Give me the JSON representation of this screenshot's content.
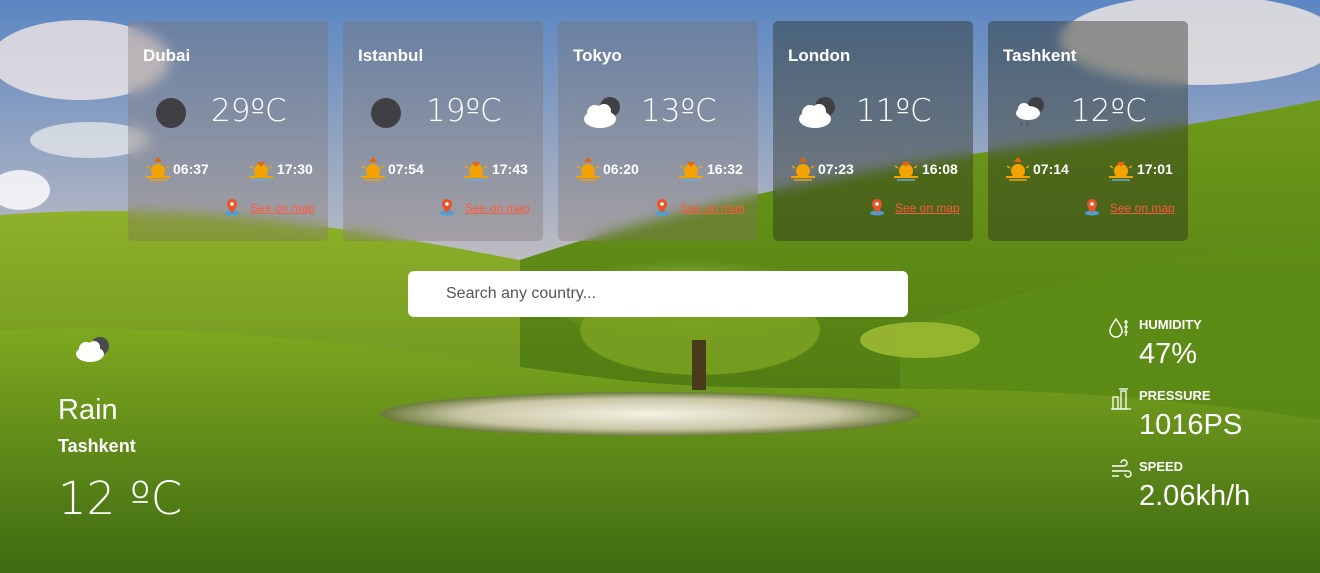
{
  "cities": [
    {
      "name": "Dubai",
      "temp": "29ºC",
      "icon": "moon-icon",
      "sunrise": "06:37",
      "sunset": "17:30",
      "map_label": "See on map"
    },
    {
      "name": "Istanbul",
      "temp": "19ºC",
      "icon": "moon-icon",
      "sunrise": "07:54",
      "sunset": "17:43",
      "map_label": "See on map"
    },
    {
      "name": "Tokyo",
      "temp": "13ºC",
      "icon": "cloud-night-icon",
      "sunrise": "06:20",
      "sunset": "16:32",
      "map_label": "See on map"
    },
    {
      "name": "London",
      "temp": "11ºC",
      "icon": "cloud-night-icon",
      "sunrise": "07:23",
      "sunset": "16:08",
      "map_label": "See on map"
    },
    {
      "name": "Tashkent",
      "temp": "12ºC",
      "icon": "rain-cloud-icon",
      "sunrise": "07:14",
      "sunset": "17:01",
      "map_label": "See on map"
    }
  ],
  "search": {
    "placeholder": "Search any country..."
  },
  "current": {
    "condition": "Rain",
    "city": "Tashkent",
    "temp": "12 ºC",
    "icon": "cloud-night-icon"
  },
  "stats": {
    "humidity": {
      "label": "HUMIDITY",
      "value": "47%"
    },
    "pressure": {
      "label": "PRESSURE",
      "value": "1016PS"
    },
    "speed": {
      "label": "SPEED",
      "value": "2.06kh/h"
    }
  },
  "colors": {
    "link": "#ff5a3c",
    "sun": "#f5a300",
    "moon": "#3f3f44"
  }
}
